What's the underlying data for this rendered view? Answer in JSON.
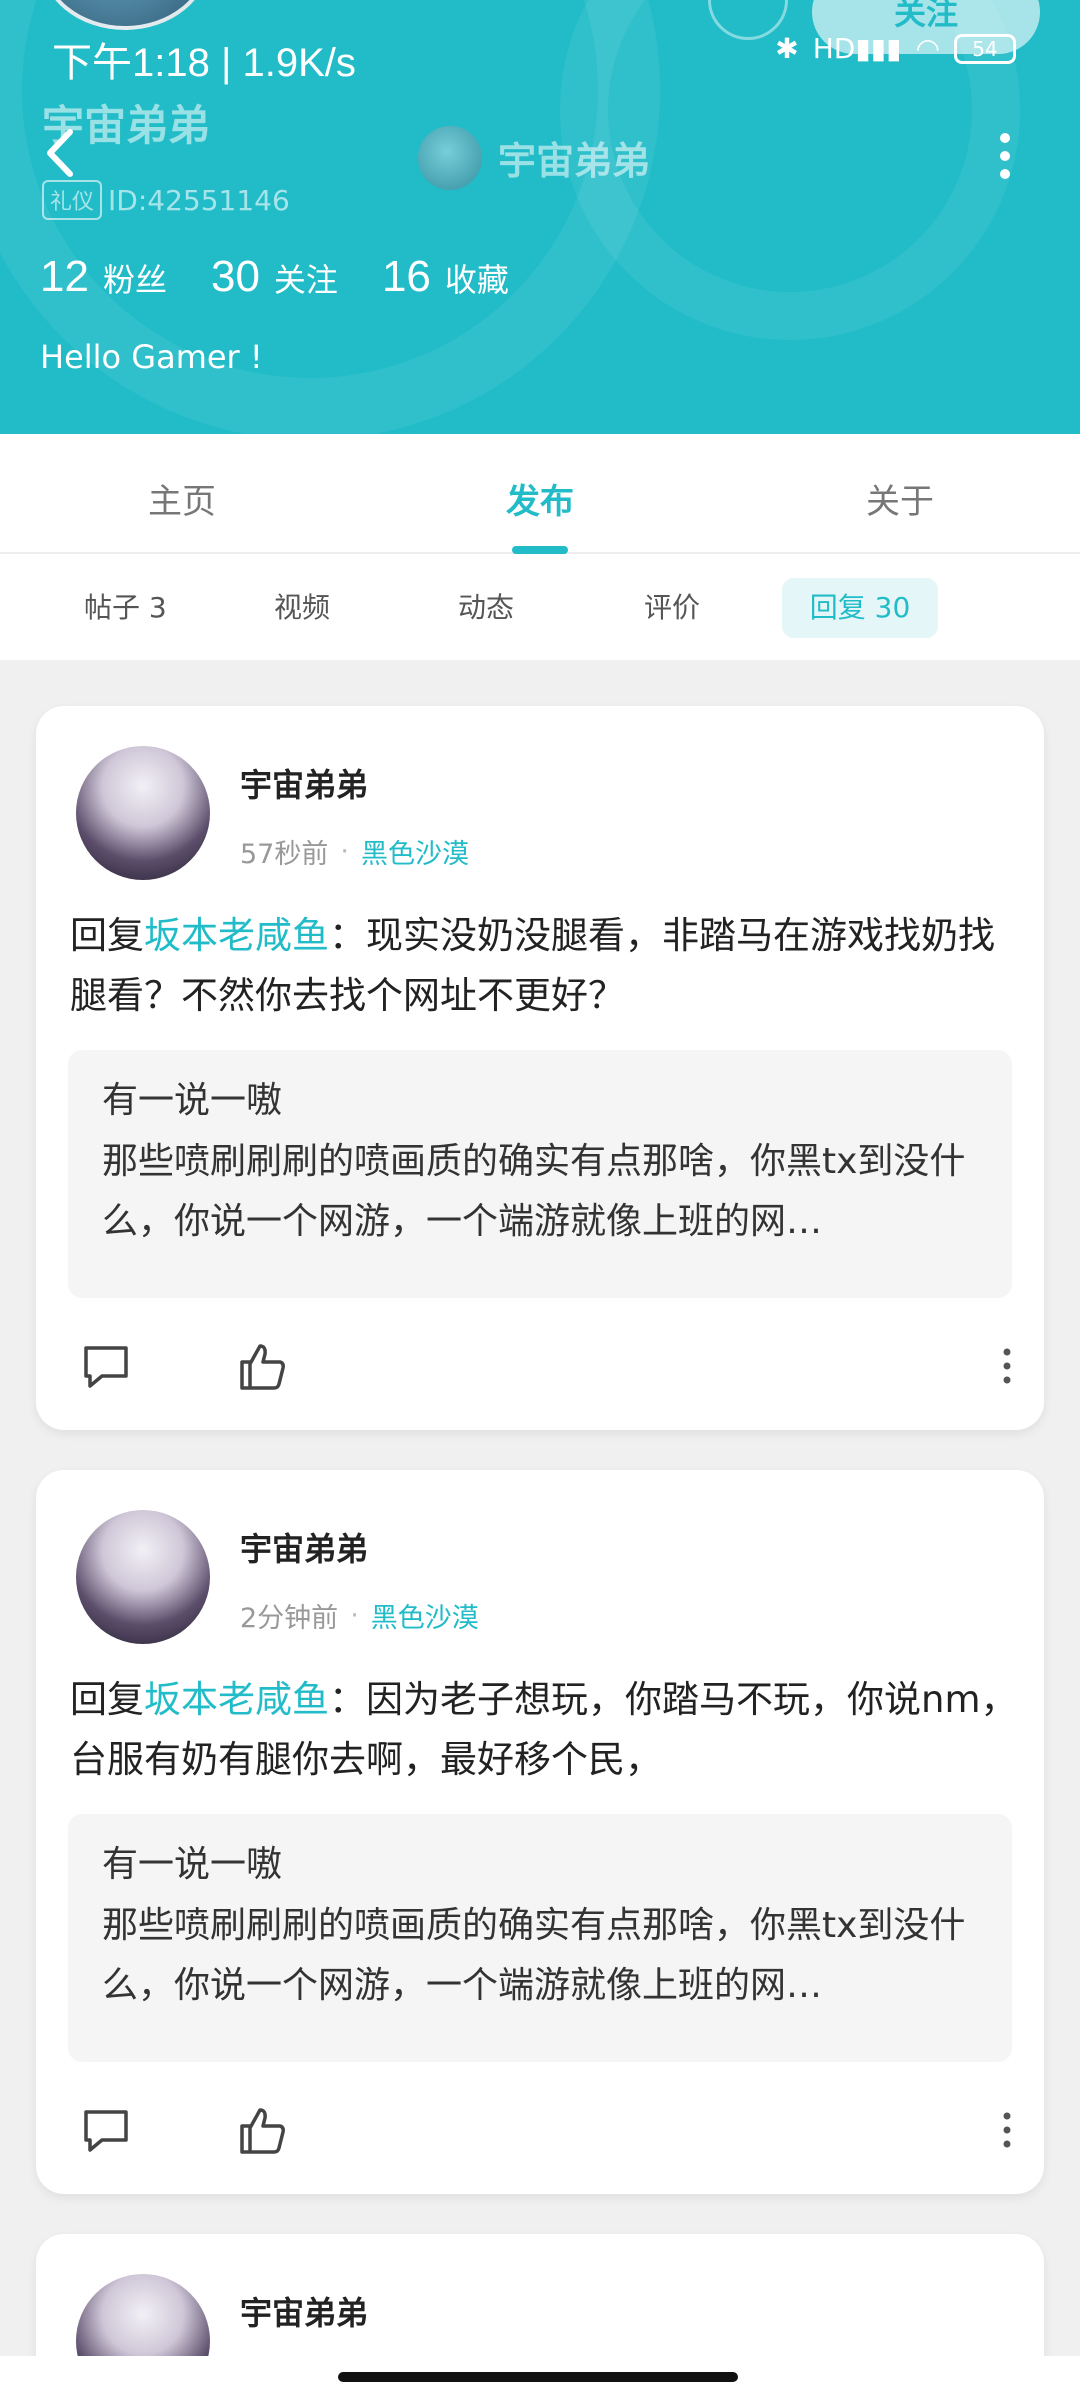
{
  "status_bar": {
    "time": "下午1:18 | 1.9K/s",
    "battery": "54",
    "signal_text": "HD"
  },
  "header": {
    "follow_button": "关注",
    "username_ghost": "宇宙弟弟",
    "title_name": "宇宙弟弟",
    "badge": "礼仪",
    "user_id": "ID:42551146",
    "stats": [
      {
        "num": "12",
        "label": "粉丝"
      },
      {
        "num": "30",
        "label": "关注"
      },
      {
        "num": "16",
        "label": "收藏"
      }
    ],
    "bio": "Hello Gamer !",
    "accent_color": "#21bcc8"
  },
  "main_tabs": [
    {
      "label": "主页"
    },
    {
      "label": "发布"
    },
    {
      "label": "关于"
    }
  ],
  "sub_tabs": [
    {
      "label": "帖子 3"
    },
    {
      "label": "视频"
    },
    {
      "label": "动态"
    },
    {
      "label": "评价"
    },
    {
      "label": "回复 30"
    }
  ],
  "posts": [
    {
      "author": "宇宙弟弟",
      "time": "57秒前",
      "game": "黑色沙漠",
      "reply_prefix": "回复",
      "mention": "坂本老咸鱼",
      "text": "：现实没奶没腿看，非踏马在游戏找奶找腿看？不然你去找个网址不更好？",
      "quote_title": "有一说一嗷",
      "quote_body": "那些喷刷刷刷的喷画质的确实有点那啥，你黑tx到没什么，你说一个网游，一个端游就像上班的网…"
    },
    {
      "author": "宇宙弟弟",
      "time": "2分钟前",
      "game": "黑色沙漠",
      "reply_prefix": "回复",
      "mention": "坂本老咸鱼",
      "text": "：因为老子想玩，你踏马不玩，你说nm，台服有奶有腿你去啊，最好移个民，",
      "quote_title": "有一说一嗷",
      "quote_body": "那些喷刷刷刷的喷画质的确实有点那啥，你黑tx到没什么，你说一个网游，一个端游就像上班的网…"
    },
    {
      "author": "宇宙弟弟"
    }
  ]
}
